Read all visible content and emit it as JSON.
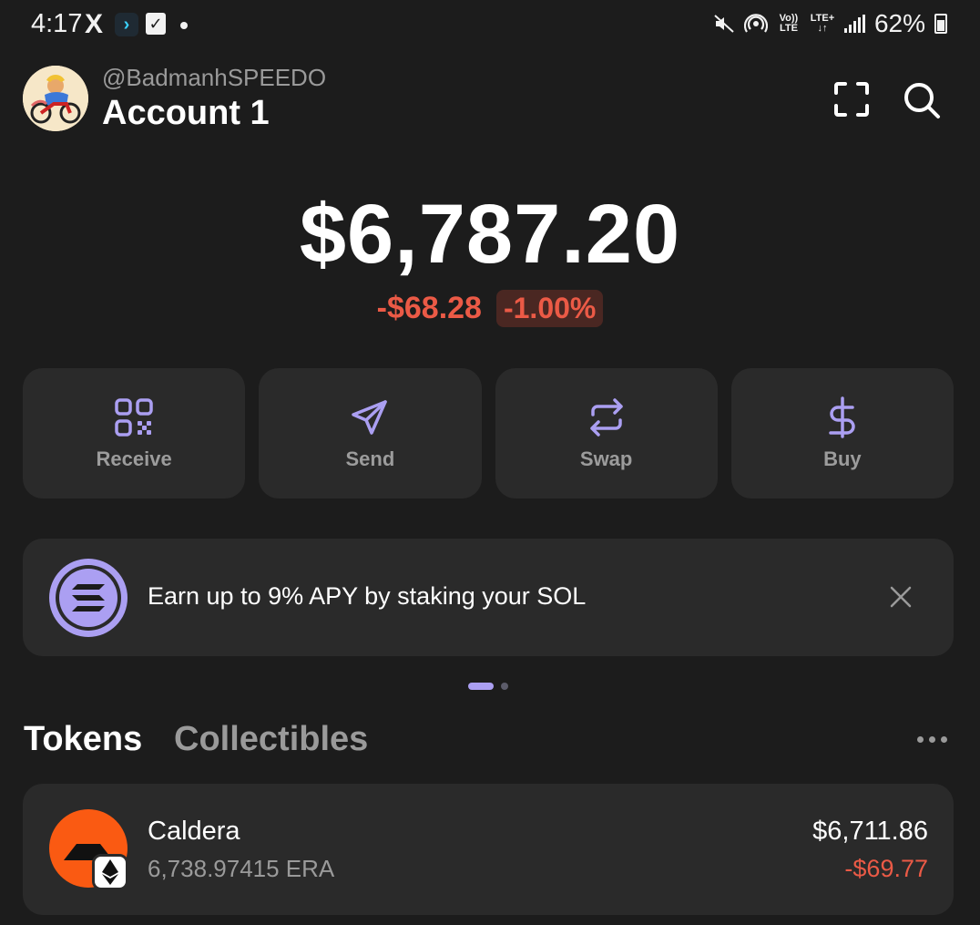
{
  "status_bar": {
    "time": "4:17",
    "x_logo": "X",
    "app_icon_1": "chevron-app-icon",
    "app_icon_2": "check-app-icon",
    "network_volte": "Vo)) LTE",
    "network_lte": "LTE+",
    "battery": "62%"
  },
  "header": {
    "handle": "@BadmanhSPEEDO",
    "account_name": "Account 1",
    "scan_icon": "scan-icon",
    "search_icon": "search-icon"
  },
  "balance": {
    "total": "$6,787.20",
    "change_abs": "-$68.28",
    "change_pct": "-1.00%"
  },
  "actions": [
    {
      "label": "Receive",
      "icon": "qr-code-icon"
    },
    {
      "label": "Send",
      "icon": "paper-plane-icon"
    },
    {
      "label": "Swap",
      "icon": "swap-arrows-icon"
    },
    {
      "label": "Buy",
      "icon": "dollar-icon"
    }
  ],
  "banner": {
    "text": "Earn up to 9% APY by staking your SOL",
    "icon": "solana-icon",
    "close_icon": "close-icon"
  },
  "pager": {
    "count": 2,
    "active": 0
  },
  "tabs": {
    "tokens": "Tokens",
    "collectibles": "Collectibles",
    "more_icon": "more-dots-icon"
  },
  "tokens": [
    {
      "name": "Caldera",
      "amount": "6,738.97415 ERA",
      "value": "$6,711.86",
      "change": "-$69.77",
      "icon": "caldera-logo-icon",
      "chain_icon": "ethereum-icon"
    }
  ],
  "colors": {
    "background": "#1c1c1c",
    "card": "#2a2a2a",
    "accent": "#ab9ff2",
    "negative": "#eb5a46",
    "token_logo": "#fa5a12"
  }
}
